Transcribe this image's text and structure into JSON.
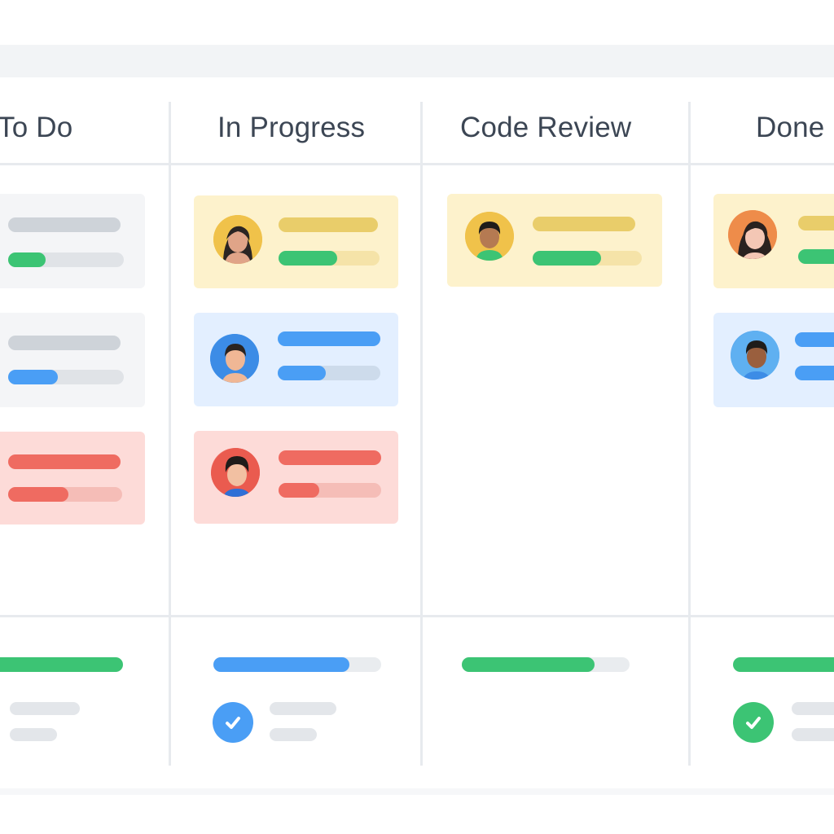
{
  "board": {
    "columns": [
      {
        "title": "To Do"
      },
      {
        "title": "In Progress"
      },
      {
        "title": "Code Review"
      },
      {
        "title": "Done"
      }
    ]
  },
  "progress": {
    "todo": 1.0,
    "in_progress": 0.81,
    "code_review": 0.79,
    "done": 1.0
  },
  "colors": {
    "green": "#3cc474",
    "blue": "#4a9ef5",
    "red": "#ef6b61",
    "yellow": "#e9cd6a",
    "gray": "#d5d9de"
  },
  "icons": [
    "user-avatar-icon",
    "checkmark-icon"
  ]
}
